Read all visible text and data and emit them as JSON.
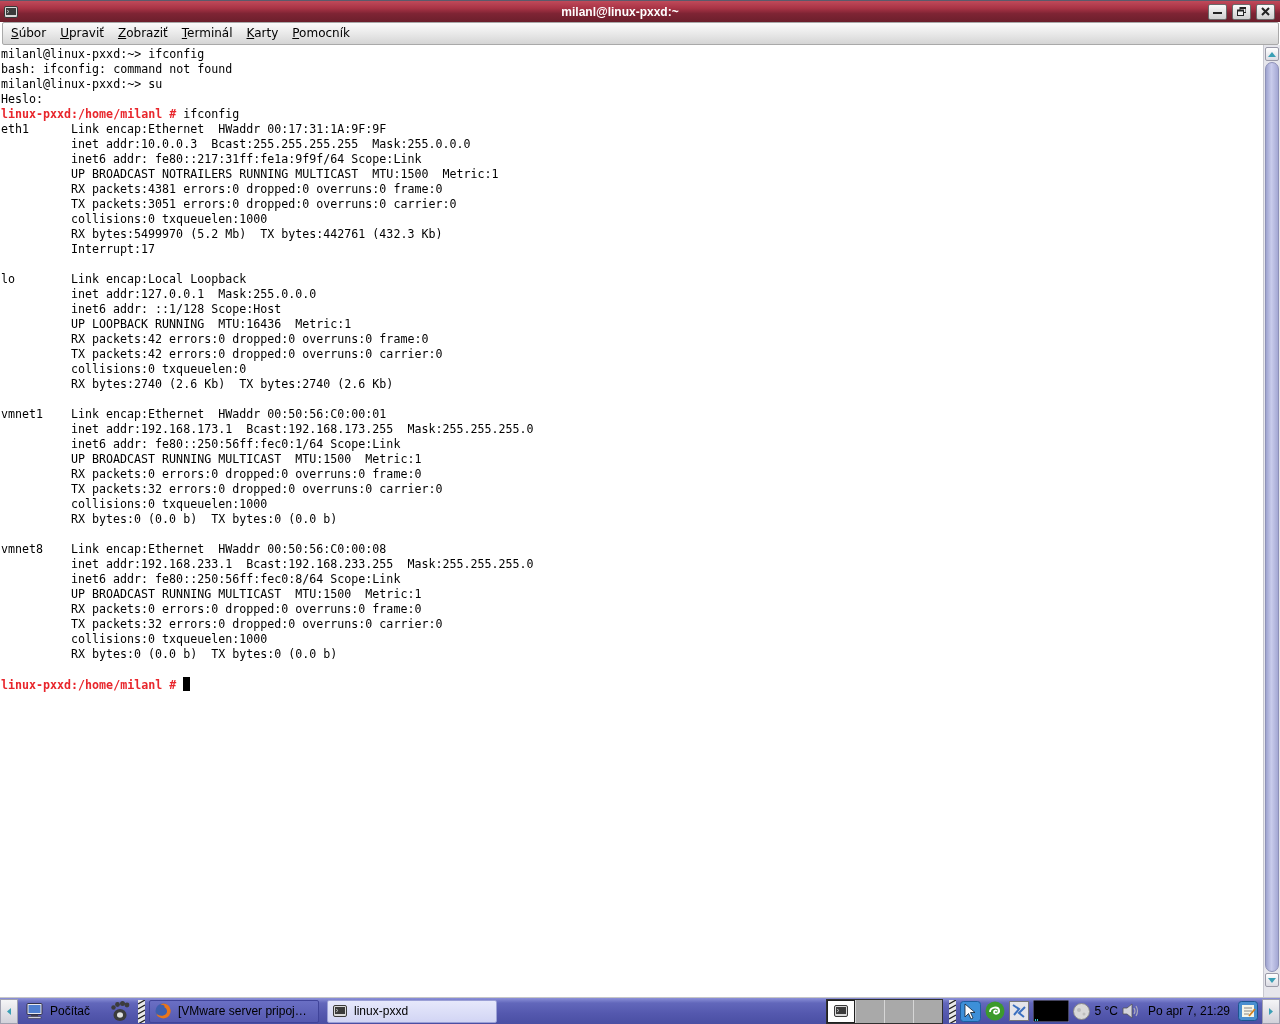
{
  "window": {
    "title": "milanl@linux-pxxd:~"
  },
  "menu": [
    {
      "label": "Súbor"
    },
    {
      "label": "Upraviť"
    },
    {
      "label": "Zobraziť"
    },
    {
      "label": "Terminál"
    },
    {
      "label": "Karty"
    },
    {
      "label": "Pomocník"
    }
  ],
  "terminal": {
    "session": [
      {
        "kind": "output",
        "text": "milanl@linux-pxxd:~> ifconfig"
      },
      {
        "kind": "output",
        "text": "bash: ifconfig: command not found"
      },
      {
        "kind": "output",
        "text": "milanl@linux-pxxd:~> su"
      },
      {
        "kind": "output",
        "text": "Heslo:"
      },
      {
        "kind": "root_prompt",
        "prompt": "linux-pxxd:/home/milanl #",
        "command": "ifconfig"
      }
    ],
    "interfaces": [
      {
        "name": "eth1",
        "lines": [
          "Link encap:Ethernet  HWaddr 00:17:31:1A:9F:9F",
          "inet addr:10.0.0.3  Bcast:255.255.255.255  Mask:255.0.0.0",
          "inet6 addr: fe80::217:31ff:fe1a:9f9f/64 Scope:Link",
          "UP BROADCAST NOTRAILERS RUNNING MULTICAST  MTU:1500  Metric:1",
          "RX packets:4381 errors:0 dropped:0 overruns:0 frame:0",
          "TX packets:3051 errors:0 dropped:0 overruns:0 carrier:0",
          "collisions:0 txqueuelen:1000",
          "RX bytes:5499970 (5.2 Mb)  TX bytes:442761 (432.3 Kb)",
          "Interrupt:17"
        ]
      },
      {
        "name": "lo",
        "lines": [
          "Link encap:Local Loopback",
          "inet addr:127.0.0.1  Mask:255.0.0.0",
          "inet6 addr: ::1/128 Scope:Host",
          "UP LOOPBACK RUNNING  MTU:16436  Metric:1",
          "RX packets:42 errors:0 dropped:0 overruns:0 frame:0",
          "TX packets:42 errors:0 dropped:0 overruns:0 carrier:0",
          "collisions:0 txqueuelen:0",
          "RX bytes:2740 (2.6 Kb)  TX bytes:2740 (2.6 Kb)"
        ]
      },
      {
        "name": "vmnet1",
        "lines": [
          "Link encap:Ethernet  HWaddr 00:50:56:C0:00:01",
          "inet addr:192.168.173.1  Bcast:192.168.173.255  Mask:255.255.255.0",
          "inet6 addr: fe80::250:56ff:fec0:1/64 Scope:Link",
          "UP BROADCAST RUNNING MULTICAST  MTU:1500  Metric:1",
          "RX packets:0 errors:0 dropped:0 overruns:0 frame:0",
          "TX packets:32 errors:0 dropped:0 overruns:0 carrier:0",
          "collisions:0 txqueuelen:1000",
          "RX bytes:0 (0.0 b)  TX bytes:0 (0.0 b)"
        ]
      },
      {
        "name": "vmnet8",
        "lines": [
          "Link encap:Ethernet  HWaddr 00:50:56:C0:00:08",
          "inet addr:192.168.233.1  Bcast:192.168.233.255  Mask:255.255.255.0",
          "inet6 addr: fe80::250:56ff:fec0:8/64 Scope:Link",
          "UP BROADCAST RUNNING MULTICAST  MTU:1500  Metric:1",
          "RX packets:0 errors:0 dropped:0 overruns:0 frame:0",
          "TX packets:32 errors:0 dropped:0 overruns:0 carrier:0",
          "collisions:0 txqueuelen:1000",
          "RX bytes:0 (0.0 b)  TX bytes:0 (0.0 b)"
        ]
      }
    ],
    "final_prompt": {
      "prompt": "linux-pxxd:/home/milanl #",
      "cursor": true
    }
  },
  "taskbar": {
    "computer_menu": {
      "label": "Počítač"
    },
    "tasks": [
      {
        "kind": "browser",
        "label": "[VMware server pripoj…",
        "selected": false
      },
      {
        "kind": "terminal",
        "label": "linux-pxxd",
        "selected": true
      }
    ],
    "workspaces": [
      {
        "selected": true
      },
      {
        "selected": false
      },
      {
        "selected": false
      },
      {
        "selected": false
      }
    ],
    "weather": {
      "temperature": "5 °C"
    },
    "clock": "Po apr 7, 21:29"
  }
}
